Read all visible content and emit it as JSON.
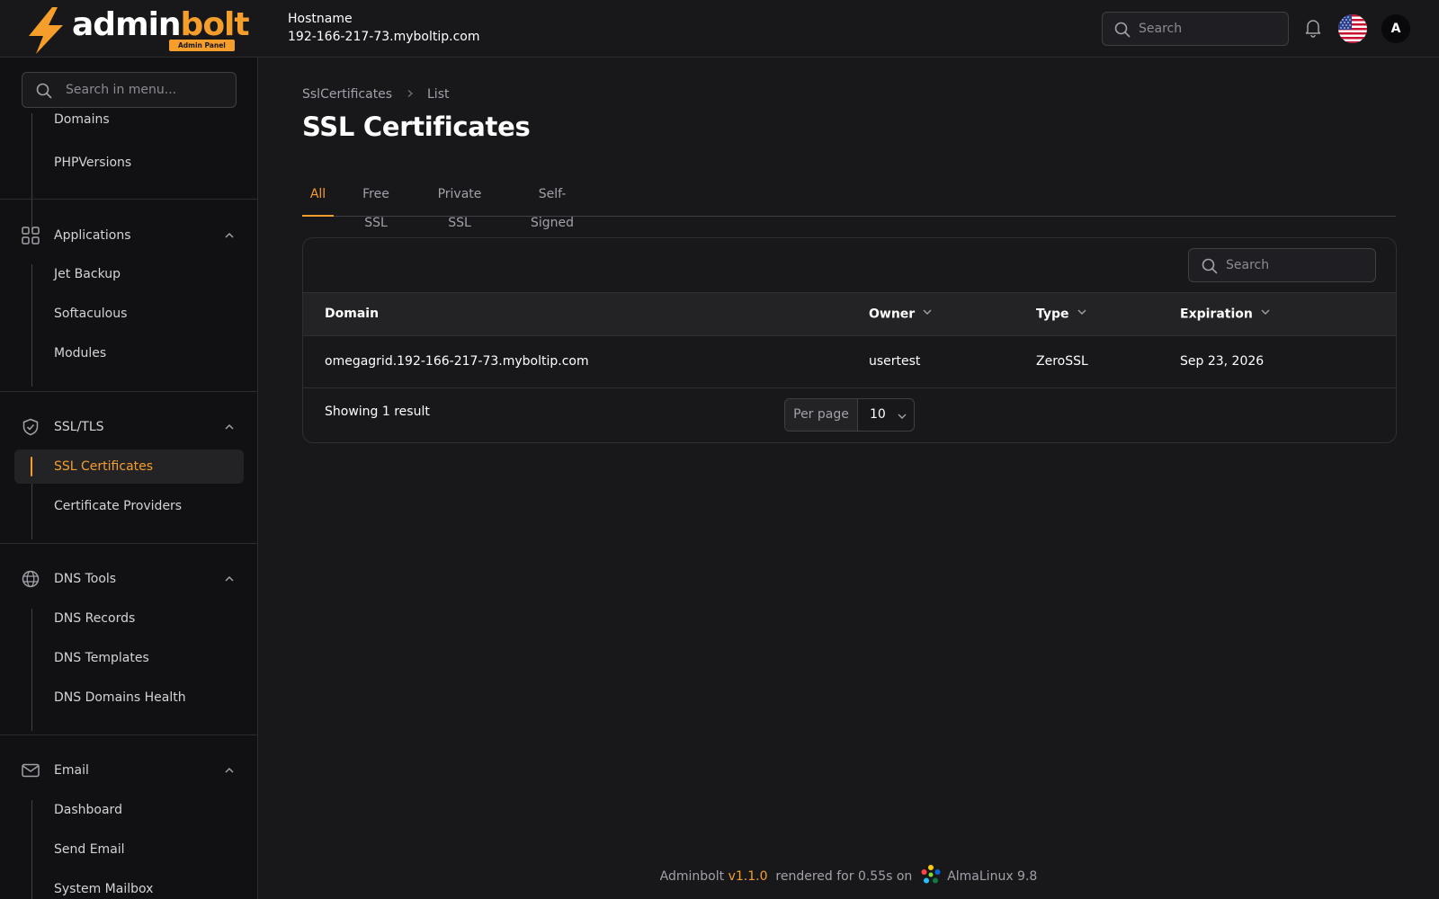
{
  "header": {
    "logo_word_a": "admin",
    "logo_word_b": "bolt",
    "logo_badge": "Admin Panel",
    "hostname_label": "Hostname",
    "hostname_value": "192-166-217-73.myboltip.com",
    "search_placeholder": "Search",
    "avatar_initial": "A"
  },
  "sidebar": {
    "search_placeholder": "Search in menu...",
    "partial_item": "Domains",
    "php_item": "PHPVersions",
    "groups": [
      {
        "label": "Applications",
        "icon": "grid-icon",
        "items": [
          "Jet Backup",
          "Softaculous",
          "Modules"
        ]
      },
      {
        "label": "SSL/TLS",
        "icon": "shield-check-icon",
        "items": [
          "SSL Certificates",
          "Certificate Providers"
        ]
      },
      {
        "label": "DNS Tools",
        "icon": "globe-icon",
        "items": [
          "DNS Records",
          "DNS Templates",
          "DNS Domains Health"
        ]
      },
      {
        "label": "Email",
        "icon": "envelope-icon",
        "items": [
          "Dashboard",
          "Send Email",
          "System Mailbox"
        ]
      }
    ],
    "active_item": "SSL Certificates"
  },
  "breadcrumb": {
    "root": "SslCertificates",
    "current": "List"
  },
  "page_title": "SSL Certificates",
  "tabs": [
    {
      "label": "All",
      "active": true
    },
    {
      "label": "Free SSL",
      "active": false
    },
    {
      "label": "Private SSL",
      "active": false
    },
    {
      "label": "Self-Signed",
      "active": false
    }
  ],
  "table": {
    "search_placeholder": "Search",
    "columns": [
      "Domain",
      "Owner",
      "Type",
      "Expiration"
    ],
    "rows": [
      {
        "domain": "omegagrid.192-166-217-73.myboltip.com",
        "owner": "usertest",
        "type": "ZeroSSL",
        "expiration": "Sep 23, 2026"
      }
    ],
    "showing": "Showing 1 result",
    "per_page_label": "Per page",
    "per_page_value": "10"
  },
  "footer": {
    "product": "Adminbolt",
    "version": "v1.1.0",
    "rendered": "rendered for 0.55s on",
    "os": "AlmaLinux 9.8"
  },
  "colors": {
    "accent": "#f59e2b",
    "background": "#18181b",
    "sidebar": "#111113"
  }
}
